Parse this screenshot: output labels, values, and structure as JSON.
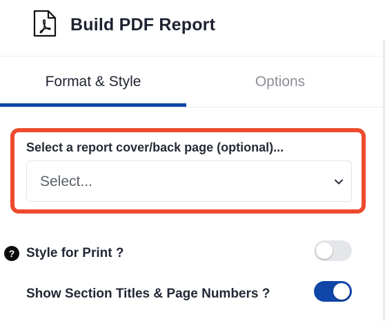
{
  "header": {
    "title": "Build PDF Report",
    "icon": "pdf-file-icon"
  },
  "tabs": [
    {
      "label": "Format & Style",
      "active": true
    },
    {
      "label": "Options",
      "active": false
    }
  ],
  "cover_page": {
    "label": "Select a report cover/back page (optional)...",
    "placeholder": "Select...",
    "highlight_color": "#ee4a2f"
  },
  "settings": [
    {
      "label": "Style for Print ?",
      "enabled": false,
      "help_icon": "?"
    },
    {
      "label": "Show Section Titles & Page Numbers ?",
      "enabled": true
    }
  ],
  "colors": {
    "accent": "#0f46a8",
    "toggle_off": "#e4e6e9"
  }
}
